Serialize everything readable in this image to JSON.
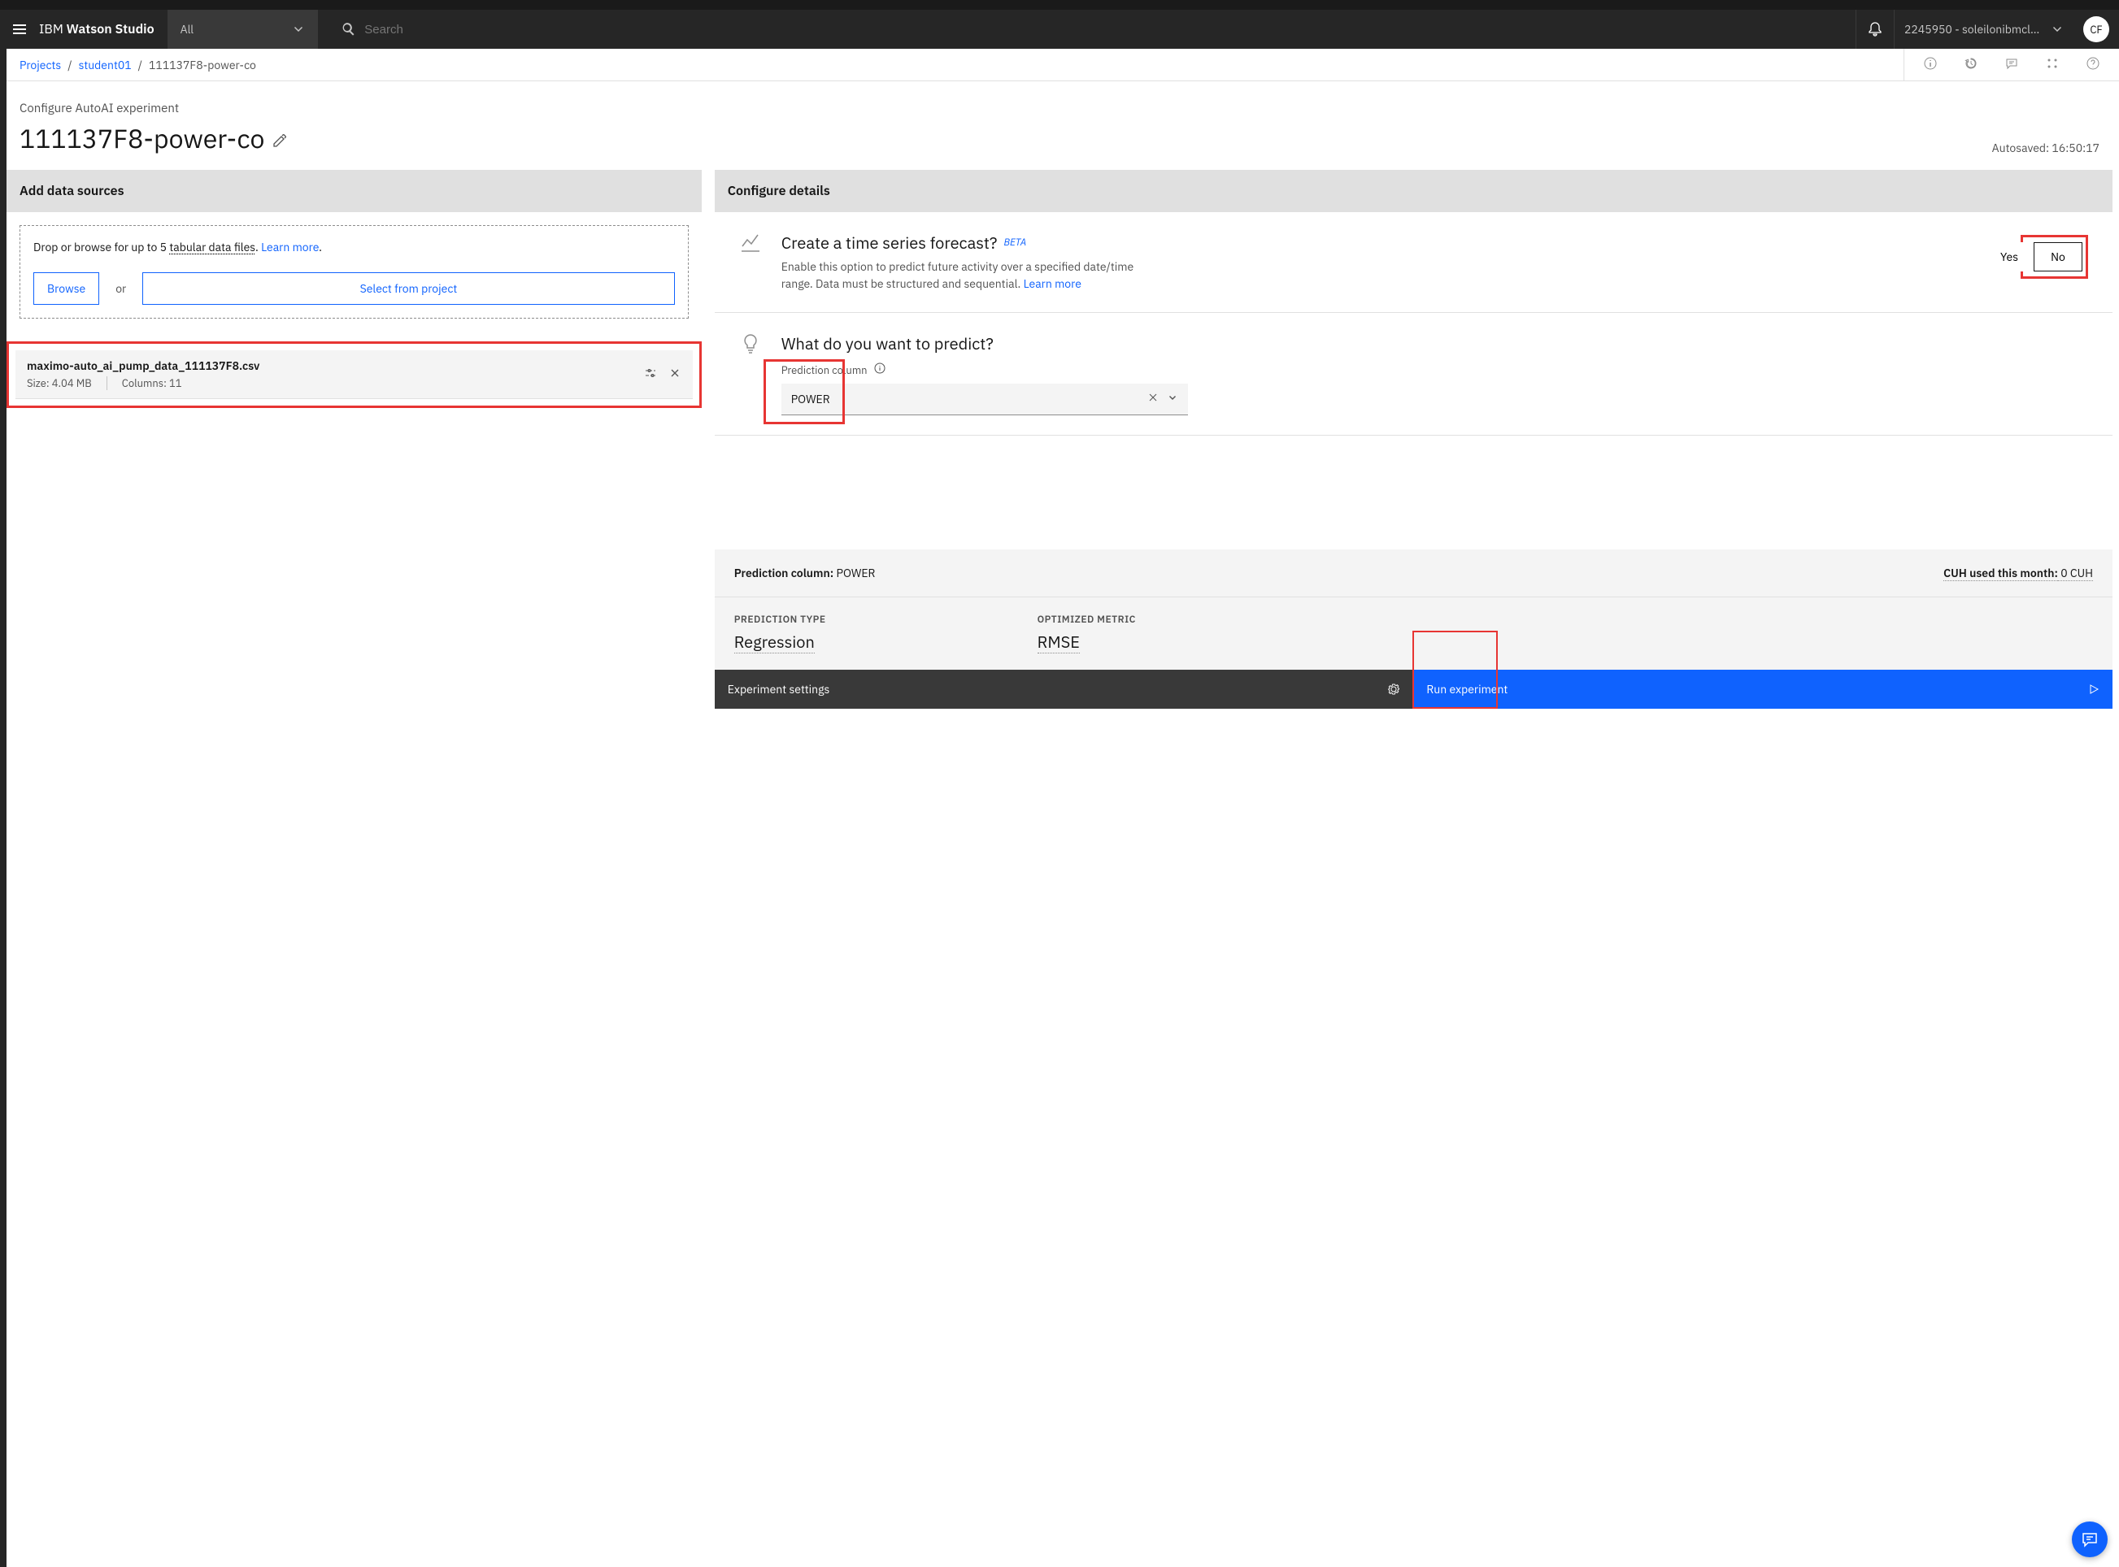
{
  "header": {
    "logo_prefix": "IBM ",
    "logo_bold": "Watson Studio",
    "filter_label": "All",
    "search_placeholder": "Search",
    "account_label": "2245950 - soleilonibmclou...",
    "avatar": "CF"
  },
  "breadcrumbs": {
    "items": [
      {
        "label": "Projects",
        "link": true
      },
      {
        "label": "student01",
        "link": true
      },
      {
        "label": "111137F8-power-co",
        "link": false
      }
    ]
  },
  "page": {
    "subtitle": "Configure AutoAI experiment",
    "title": "111137F8-power-co",
    "autosaved": "Autosaved: 16:50:17"
  },
  "data_sources": {
    "header": "Add data sources",
    "drop_text_pre": "Drop or browse for up to 5 ",
    "drop_text_u": "tabular data files",
    "drop_text_post": ". ",
    "learn_more": "Learn more",
    "period": ".",
    "browse": "Browse",
    "or": "or",
    "select_project": "Select from project",
    "file": {
      "name": "maximo-auto_ai_pump_data_111137F8.csv",
      "size": "Size: 4.04 MB",
      "columns": "Columns: 11"
    }
  },
  "configure": {
    "header": "Configure details",
    "ts": {
      "title": "Create a time series forecast?",
      "beta": "BETA",
      "desc_pre": "Enable this option to predict future activity over a specified date/time range. Data must be structured and sequential. ",
      "learn": "Learn more",
      "yes": "Yes",
      "no": "No"
    },
    "predict": {
      "title": "What do you want to predict?",
      "label": "Prediction column",
      "value": "POWER"
    }
  },
  "summary": {
    "pred_col_label": "Prediction column:",
    "pred_col_val": " POWER",
    "cuh_label": "CUH used this month:",
    "cuh_val": " 0 CUH",
    "type_label": "PREDICTION TYPE",
    "type_val": "Regression",
    "metric_label": "OPTIMIZED METRIC",
    "metric_val": "RMSE"
  },
  "bottom": {
    "settings": "Experiment settings",
    "run": "Run experiment"
  }
}
